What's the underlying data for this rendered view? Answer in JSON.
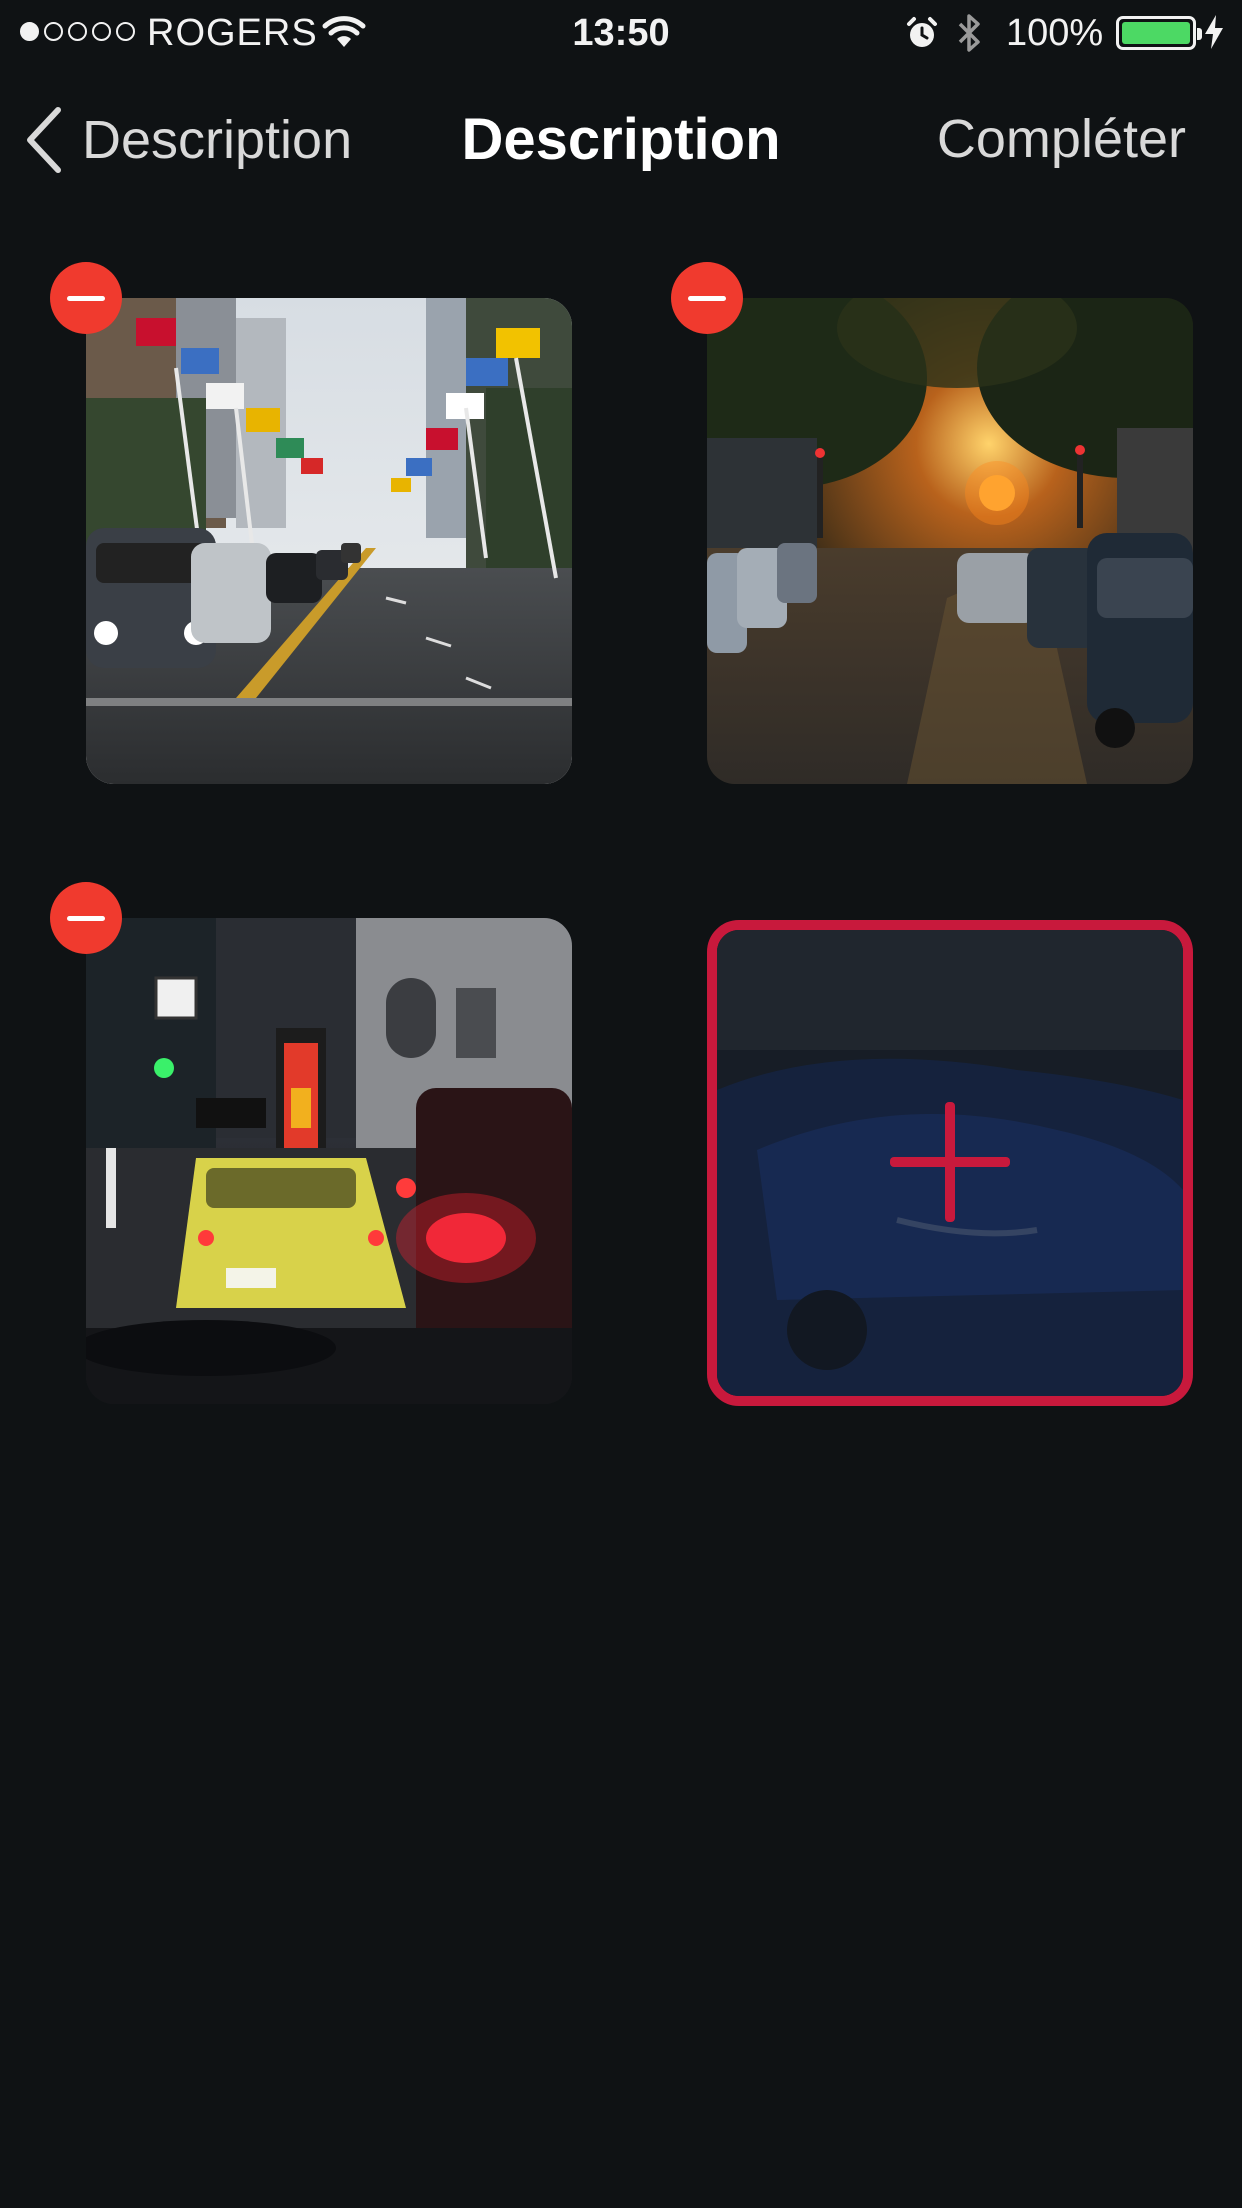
{
  "status_bar": {
    "carrier": "ROGERS",
    "time": "13:50",
    "battery_percent": "100%",
    "signal_bars_filled": 1,
    "signal_bars_total": 5
  },
  "nav": {
    "back_label": "Description",
    "title": "Description",
    "done_label": "Compléter"
  },
  "photos": [
    {
      "icon": "remove-icon"
    },
    {
      "icon": "remove-icon"
    },
    {
      "icon": "remove-icon"
    }
  ],
  "add_photo": {
    "icon": "plus-icon"
  },
  "colors": {
    "background": "#0f1214",
    "remove_button": "#f03a2e",
    "add_accent": "#c8193c",
    "battery": "#4cd964"
  }
}
